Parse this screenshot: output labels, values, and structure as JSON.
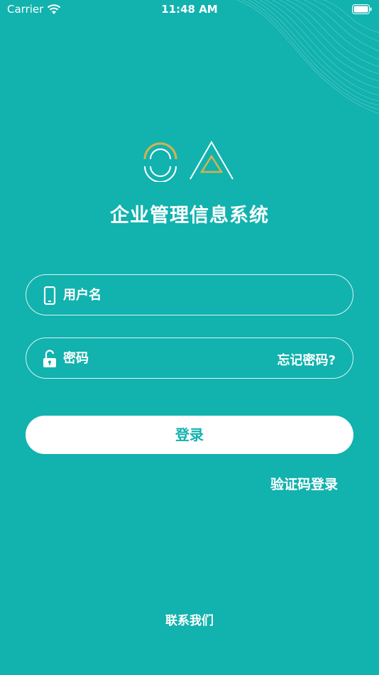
{
  "status_bar": {
    "carrier": "Carrier",
    "time": "11:48 AM"
  },
  "app": {
    "title": "企业管理信息系统"
  },
  "login_form": {
    "username_label": "用户名",
    "password_label": "密码",
    "forgot_password": "忘记密码?",
    "login_button": "登录",
    "sms_login": "验证码登录",
    "contact_us": "联系我们"
  },
  "icons": {
    "wifi": "wifi-icon",
    "battery": "battery-icon",
    "phone": "phone-icon",
    "lock": "lock-icon",
    "logo": "oa-logo"
  },
  "colors": {
    "background": "#12b2ae",
    "accent_gold": "#d6b24b",
    "text": "#ffffff"
  }
}
